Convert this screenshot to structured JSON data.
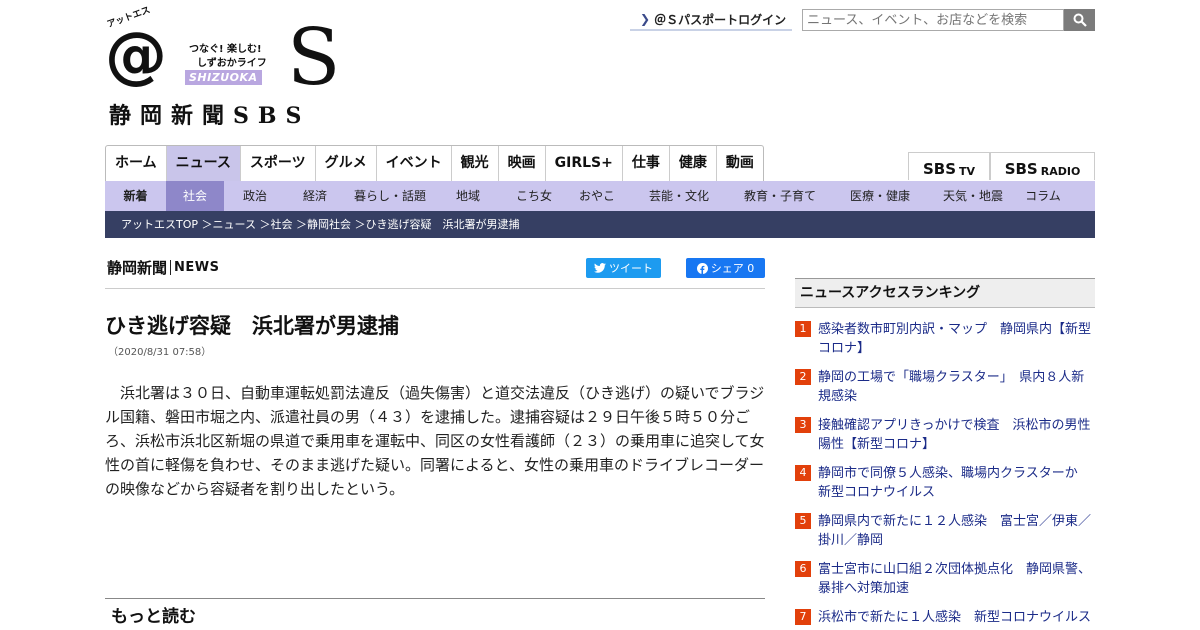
{
  "logo": {
    "kana": "アットエス",
    "tagline1": "つなぐ! 楽しむ!",
    "tagline2": "しずおかライフ",
    "shizuoka": "SHIZUOKA",
    "at": "@",
    "s": "S",
    "name": "静岡新聞SBS"
  },
  "header": {
    "login_label": "＠Ｓパスポートログイン",
    "search_placeholder": "ニュース、イベント、お店などを検索"
  },
  "nav": {
    "items": [
      "ホーム",
      "ニュース",
      "スポーツ",
      "グルメ",
      "イベント",
      "観光",
      "映画",
      "GIRLS+",
      "仕事",
      "健康",
      "動画"
    ],
    "active_index": 1
  },
  "brands": [
    {
      "main": "SBS",
      "sub": "TV"
    },
    {
      "main": "SBS",
      "sub": "RADIO"
    }
  ],
  "subnav": {
    "items": [
      "新着",
      "社会",
      "政治",
      "経済",
      "暮らし・話題",
      "地域",
      "こち女",
      "おやこ",
      "芸能・文化",
      "教育・子育て",
      "医療・健康",
      "天気・地震",
      "コラム"
    ]
  },
  "breadcrumb": "アットエスTOP ＞ニュース ＞社会 ＞静岡社会 ＞ひき逃げ容疑　浜北署が男逮捕",
  "article": {
    "brand_main": "静岡新聞",
    "brand_sub": "NEWS",
    "tweet_label": "ツイート",
    "share_label": "シェア 0",
    "headline": "ひき逃げ容疑　浜北署が男逮捕",
    "date": "（2020/8/31 07:58）",
    "body": "　浜北署は３０日、自動車運転処罰法違反（過失傷害）と道交法違反（ひき逃げ）の疑いでブラジル国籍、磐田市堀之内、派遣社員の男（４３）を逮捕した。逮捕容疑は２９日午後５時５０分ごろ、浜松市浜北区新堀の県道で乗用車を運転中、同区の女性看護師（２３）の乗用車に追突して女性の首に軽傷を負わせ、そのまま逃げた疑い。同署によると、女性の乗用車のドライブレコーダーの映像などから容疑者を割り出したという。",
    "more_label": "もっと読む"
  },
  "ranking": {
    "title": "ニュースアクセスランキング",
    "items": [
      {
        "num": "1",
        "text": "感染者数市町別内訳・マップ　静岡県内【新型コロナ】"
      },
      {
        "num": "2",
        "text": "静岡の工場で「職場クラスター」　県内８人新規感染"
      },
      {
        "num": "3",
        "text": "接触確認アプリきっかけで検査　浜松市の男性陽性【新型コロナ】"
      },
      {
        "num": "4",
        "text": "静岡市で同僚５人感染、職場内クラスターか　新型コロナウイルス"
      },
      {
        "num": "5",
        "text": "静岡県内で新たに１２人感染　富士宮／伊東／掛川／静岡"
      },
      {
        "num": "6",
        "text": "富士宮市に山口組２次団体拠点化　静岡県警、暴排へ対策加速"
      },
      {
        "num": "7",
        "text": "浜松市で新たに１人感染　新型コロナウイルス"
      }
    ]
  },
  "colors": {
    "nav_active": "#c9c5ea",
    "subnav_bg": "#cbc6ee",
    "subnav_active": "#8e87c9",
    "breadcrumb_bg": "#363f63",
    "rank_num": "#e2400b",
    "rank_link": "#1b2b88",
    "tweet": "#1d9bf0",
    "share": "#1877f2"
  }
}
